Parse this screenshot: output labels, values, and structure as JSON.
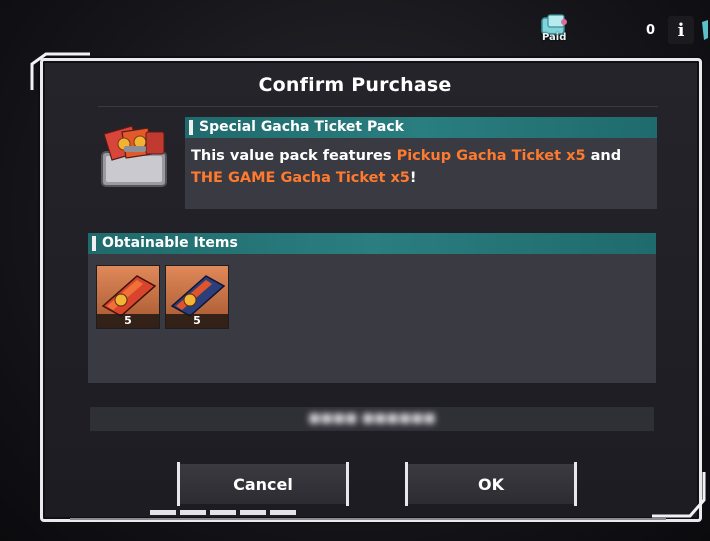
{
  "topbar": {
    "paid_label": "Paid",
    "paid_count": "0",
    "info_icon_label": "i"
  },
  "dialog": {
    "title": "Confirm Purchase",
    "pack": {
      "name": "Special Gacha Ticket Pack",
      "desc_prefix": "This value pack features ",
      "highlight_1": "Pickup Gacha Ticket x5",
      "desc_mid": " and",
      "highlight_2": "THE GAME Gacha Ticket x5",
      "desc_suffix": "!"
    },
    "obtainable": {
      "header": "Obtainable Items",
      "items": [
        {
          "name": "Pickup Gacha Ticket",
          "qty": "5",
          "icon": "orange-ticket-icon"
        },
        {
          "name": "THE GAME Gacha Ticket",
          "qty": "5",
          "icon": "blue-ticket-icon"
        }
      ]
    },
    "buttons": {
      "cancel": "Cancel",
      "ok": "OK"
    }
  },
  "colors": {
    "accent_teal": "#2a7e80",
    "highlight_orange": "#ff7a2e",
    "panel": "#3a3a42",
    "dialog_bg": "#202026"
  }
}
